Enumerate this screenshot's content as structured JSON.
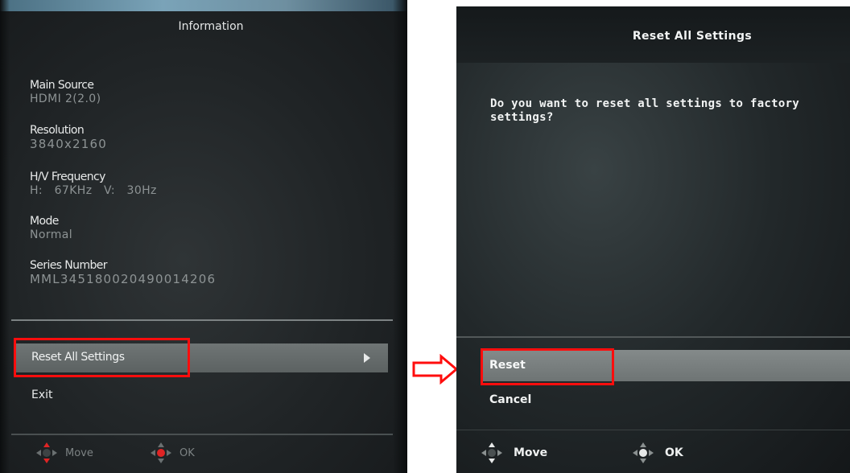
{
  "left_screen": {
    "title": "Information",
    "info": [
      {
        "label": "Main Source",
        "value": "HDMI 2(2.0)"
      },
      {
        "label": "Resolution",
        "value": "3840x2160"
      },
      {
        "label": "H/V Frequency",
        "value": "H:   67KHz   V:   30Hz"
      },
      {
        "label": "Mode",
        "value": "Normal"
      },
      {
        "label": "Series Number",
        "value": "MML345180020490014206"
      }
    ],
    "menu": {
      "selected": "Reset All Settings",
      "second": "Exit"
    },
    "footer": {
      "move_label": "Move",
      "ok_label": "OK"
    }
  },
  "right_screen": {
    "title": "Reset All Settings",
    "question": "Do you want to reset all settings to factory settings?",
    "options": [
      "Reset",
      "Cancel"
    ],
    "footer": {
      "move_label": "Move",
      "ok_label": "OK"
    }
  },
  "colors": {
    "highlight": "#ff0d0d",
    "left_dpad_accent": "#e02424",
    "right_dpad_accent": "#e6e8e8"
  },
  "icons": {
    "selection_arrow": "play-triangle-icon",
    "move_control": "dpad-move-icon",
    "ok_control": "dpad-ok-icon",
    "flow_arrow": "right-arrow-icon"
  }
}
